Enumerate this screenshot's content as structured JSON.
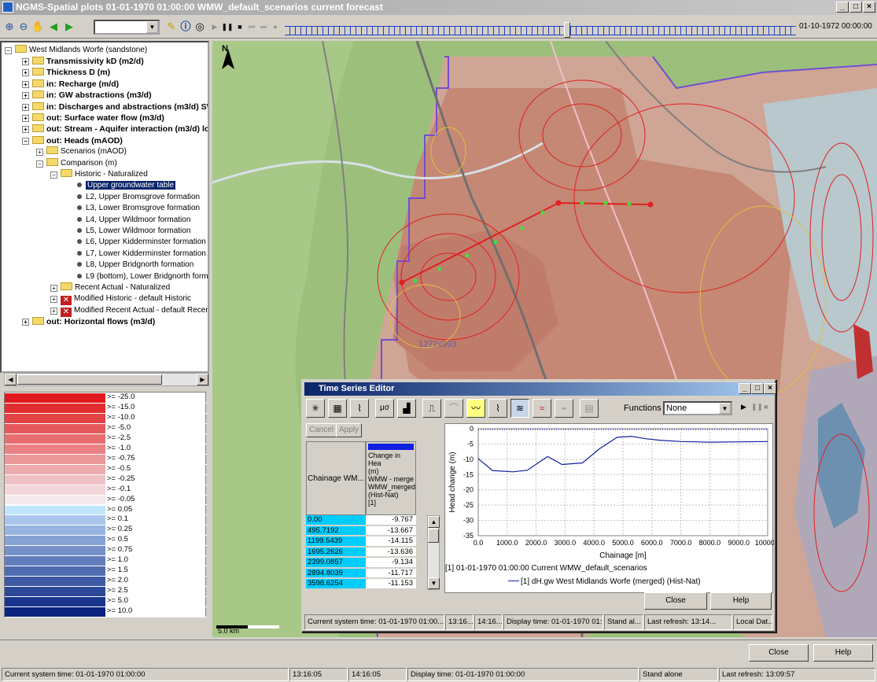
{
  "window": {
    "title": "NGMS-Spatial plots 01-01-1970 01:00:00 WMW_default_scenarios current forecast",
    "min": "_",
    "max": "□",
    "close": "×"
  },
  "toolbar": {
    "end_date": "01-10-1972 00:00:00",
    "progress": 0.55
  },
  "tree": {
    "root": "West Midlands Worfe (sandstone)",
    "items": [
      "Transmissivity kD (m2/d)",
      "Thickness D (m)",
      "in: Recharge (m/d)",
      "in: GW abstractions (m3/d)",
      "in: Discharges and abstractions (m3/d) SW",
      "out: Surface water flow (m3/d)",
      "out: Stream - Aquifer interaction (m3/d) los",
      "out: Heads (mAOD)"
    ],
    "heads_children": [
      "Scenarios (mAOD)",
      "Comparison (m)"
    ],
    "comparison_children": [
      "Historic - Naturalized"
    ],
    "historic_children": [
      "Upper groundwater table",
      "L2, Upper Bromsgrove formation",
      "L3, Lower Bromsgrove formation",
      "L4, Upper Wildmoor formation",
      "L5, Lower Wildmoor formation",
      "L6, Upper Kidderminster formation",
      "L7, Lower Kidderminster formation",
      "L8, Upper Bridgnorth formation",
      "L9 (bottom), Lower Bridgnorth forma"
    ],
    "comparison_more": [
      "Recent Actual - Naturalized",
      "Modified Historic - default Historic",
      "Modified Recent Actual - default Recent"
    ],
    "last": "out: Horizontal flows (m3/d)"
  },
  "legend": [
    {
      "label": ">= -25.0",
      "color": "#e0191c"
    },
    {
      "label": ">= -15.0",
      "color": "#e22e30"
    },
    {
      "label": ">= -10.0",
      "color": "#e44346"
    },
    {
      "label": ">= -5.0",
      "color": "#e6585b"
    },
    {
      "label": ">= -2.5",
      "color": "#e86d70"
    },
    {
      "label": ">= -1.0",
      "color": "#ea8285"
    },
    {
      "label": ">= -0.75",
      "color": "#ec979a"
    },
    {
      "label": ">= -0.5",
      "color": "#eeacaf"
    },
    {
      "label": ">= -0.25",
      "color": "#f0c1c4"
    },
    {
      "label": ">= -0.1",
      "color": "#f2d6d9"
    },
    {
      "label": ">= -0.05",
      "color": "#f4eaee"
    },
    {
      "label": ">= 0.05",
      "color": "#bfe6fa"
    },
    {
      "label": ">= 0.1",
      "color": "#aac6ec"
    },
    {
      "label": ">= 0.25",
      "color": "#98b4e0"
    },
    {
      "label": ">= 0.5",
      "color": "#86a2d4"
    },
    {
      "label": ">= 0.75",
      "color": "#7490c8"
    },
    {
      "label": ">= 1.0",
      "color": "#627ebc"
    },
    {
      "label": ">= 1.5",
      "color": "#506cb0"
    },
    {
      "label": ">= 2.0",
      "color": "#3e5aa4"
    },
    {
      "label": ">= 2.5",
      "color": "#2c4898"
    },
    {
      "label": ">= 5.0",
      "color": "#1a368c"
    },
    {
      "label": ">= 10.0",
      "color": "#0a2480"
    }
  ],
  "map": {
    "north": "N",
    "dimension_label": "1277x993",
    "scale": "5.0 km"
  },
  "tse": {
    "title": "Time Series Editor",
    "functions_label": "Functions",
    "functions_value": "None",
    "cancel": "Cancel",
    "apply": "Apply",
    "col1": "Chainage WM...",
    "col2_lines": [
      "Change in Hea",
      "(m)",
      "WMW - merge",
      "WMW_merged",
      "(Hist-Nat)",
      "[1]"
    ],
    "rows": [
      [
        "0.00",
        "-9.767"
      ],
      [
        "495.7192",
        "-13.667"
      ],
      [
        "1199.5439",
        "-14.115"
      ],
      [
        "1695.2626",
        "-13.636"
      ],
      [
        "2399.0857",
        "-9.134"
      ],
      [
        "2894.8039",
        "-11.717"
      ],
      [
        "3598.6254",
        "-11.153"
      ]
    ],
    "chart_caption": "[1] 01-01-1970 01:00:00 Current WMW_default_scenarios",
    "chart_legend": "[1] dH.gw West Midlands Worfe (merged) (Hist-Nat)",
    "close": "Close",
    "help": "Help",
    "status": [
      "Current system time: 01-01-1970 01:00...",
      "13:16...",
      "14:16...",
      "Display time: 01-01-1970 01:00...",
      "Stand al...",
      "Last refresh: 13:14...",
      "Local Dat..."
    ]
  },
  "chart_data": {
    "type": "line",
    "xlabel": "Chainage [m]",
    "ylabel": "Head change (m)",
    "xlim": [
      0,
      10000
    ],
    "ylim": [
      -35,
      0
    ],
    "xticks": [
      "0.0",
      "1000.0",
      "2000.0",
      "3000.0",
      "4000.0",
      "5000.0",
      "6000.0",
      "7000.0",
      "8000.0",
      "9000.0",
      "10000.0"
    ],
    "yticks": [
      "0",
      "-5",
      "-10",
      "-15",
      "-20",
      "-25",
      "-30",
      "-35"
    ],
    "grid": true,
    "series": [
      {
        "name": "[1] dH.gw West Midlands Worfe (merged) (Hist-Nat)",
        "x": [
          0,
          495.7,
          1199.5,
          1695.3,
          2399.1,
          2894.8,
          3598.6,
          4200,
          4800,
          5300,
          5800,
          6300,
          7000,
          8000,
          9000,
          10000
        ],
        "y": [
          -9.8,
          -13.7,
          -14.1,
          -13.6,
          -9.1,
          -11.7,
          -11.2,
          -6.5,
          -2.8,
          -2.5,
          -3.3,
          -3.8,
          -4.2,
          -4.4,
          -4.3,
          -4.2
        ]
      }
    ]
  },
  "main": {
    "close": "Close",
    "help": "Help"
  },
  "status": {
    "system_time": "Current system time: 01-01-1970 01:00:00",
    "t1": "13:16:05",
    "t2": "14:16:05",
    "display_time": "Display time: 01-01-1970 01:00:00",
    "mode": "Stand alone",
    "refresh": "Last refresh: 13:09:57"
  }
}
